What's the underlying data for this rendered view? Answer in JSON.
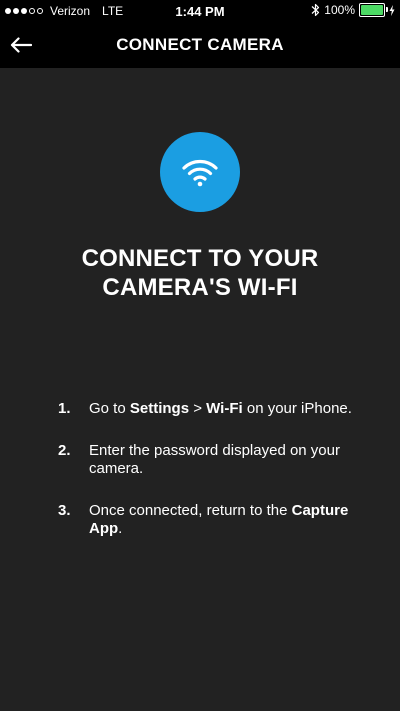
{
  "status_bar": {
    "signal_dots": [
      "filled",
      "filled",
      "filled",
      "empty",
      "empty"
    ],
    "carrier": "Verizon",
    "network": "LTE",
    "time": "1:44 PM",
    "bluetooth_icon": "bluetooth-icon",
    "battery_percent": "100%",
    "battery_level": 1.0,
    "battery_color": "#4cd964"
  },
  "header": {
    "back_icon": "arrow-left-icon",
    "title": "CONNECT CAMERA"
  },
  "main": {
    "badge_icon": "wifi-icon",
    "badge_color": "#1b9ee2",
    "headline_line1": "CONNECT TO YOUR",
    "headline_line2": "CAMERA'S WI-FI",
    "steps": [
      {
        "number": "1.",
        "text_a": "Go to ",
        "bold_a": "Settings",
        "text_b": " > ",
        "bold_b": "Wi-Fi",
        "text_c": " on your iPhone."
      },
      {
        "number": "2.",
        "text": "Enter the password displayed on your camera."
      },
      {
        "number": "3.",
        "text_a": "Once connected, return to the ",
        "bold_a": "Capture App",
        "text_b": "."
      }
    ]
  }
}
